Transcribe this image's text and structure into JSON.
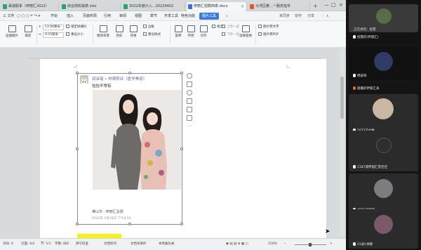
{
  "wps": {
    "tabs": [
      {
        "label": "渠道联系（伊丽汇2022）",
        "color": "#2fa36b",
        "active": false
      },
      {
        "label": "综合岗实操表.xlsx",
        "color": "#2fa36b",
        "active": false
      },
      {
        "label": "2022年度计入…20220402",
        "color": "#2fa36b",
        "active": false
      },
      {
        "label": "伊丽汇招聘简章.docx",
        "color": "#3b6fd4",
        "active": true
      },
      {
        "label": "大湾区教…一服务指专",
        "color": "#e4572e",
        "active": false
      }
    ],
    "menu": {
      "file_label": "三 文件",
      "items": [
        "开始",
        "插入",
        "页面布局",
        "引用",
        "审阅",
        "视图",
        "章节",
        "开发工具",
        "特色功能"
      ],
      "active_item": "图片工具",
      "right": [
        "未同步",
        "协作",
        "分享"
      ]
    },
    "ribbon": {
      "add_picture": "压缩图片",
      "crop": "裁剪",
      "width_value": "13.94厘米",
      "height_value": "9.55厘米",
      "lock_ratio": "锁定纵横比",
      "reset_size": "重设大小",
      "remove_bg": "抠除背景",
      "color": "色彩",
      "effects": "效果",
      "border": "边框",
      "reset_style": "重设样式",
      "rotate": "旋转",
      "wrap": "环绕",
      "align": "对齐",
      "combine": "组合",
      "bring_forward": "上移一层",
      "send_backward": "下移一层",
      "select_pane": "选择窗格",
      "picture_to_text": "图片转文字",
      "picture_to_pdf": "图片转PDF"
    },
    "post": {
      "username": "润泽瑶 • 帅哥职业（医学美容）",
      "text": "包包不常有",
      "location": "佛山市 · 伊丽汇总部",
      "time": "2022年 4月28日 下午8:59"
    },
    "status": {
      "page": "页码: 4",
      "pages": "页面: 4/4",
      "section": "节: 1/1",
      "words": "字数: 882",
      "spell": "拼写检查",
      "doc_check": "文档校对",
      "protect": "文档未保护",
      "missing_font": "本地备份关",
      "zoom": "150%"
    }
  },
  "meeting": {
    "speaking_label": "正在讲话：张慧",
    "participants": [
      {
        "name": "招慧的(伊丽汇)",
        "avatar_color": "#5a6b4a"
      },
      {
        "name": "韩安阳",
        "avatar_color": "#3a4c7a"
      },
      {
        "name": "丽雅的伊丽汇表",
        "avatar_color": "#6a5a50"
      },
      {
        "name": "2073冯文敏",
        "avatar_color": "#c9b7a4"
      },
      {
        "name": "1187源伊丽汇曾佳佳",
        "avatar_color": "#2e2e2e"
      },
      {
        "name": "4001冯丽丽",
        "avatar_color": "#7d7d80"
      },
      {
        "name": "21录1林颖",
        "avatar_color": "#7a5a6a"
      }
    ]
  }
}
